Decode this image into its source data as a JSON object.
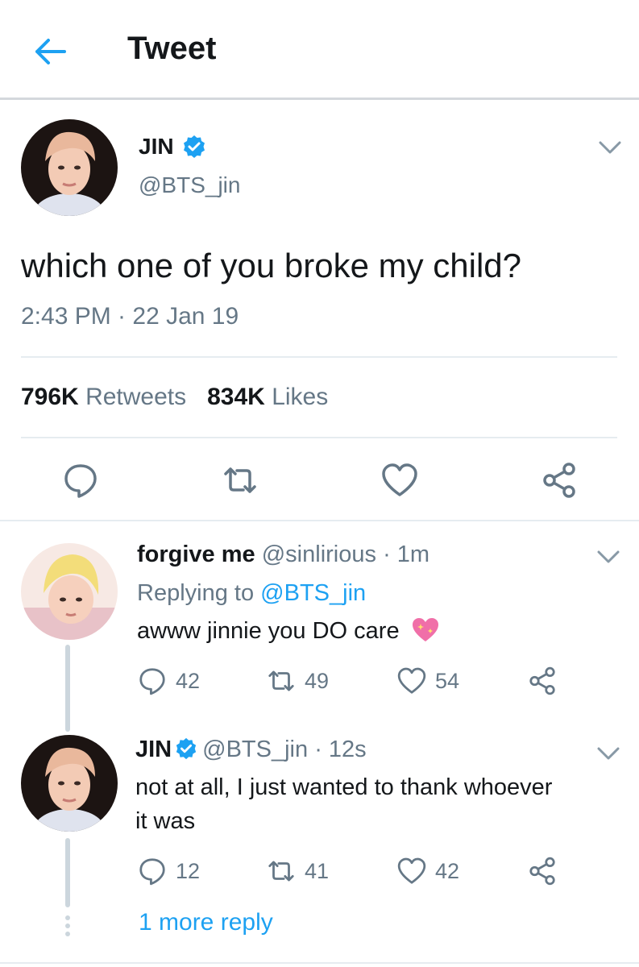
{
  "header": {
    "title": "Tweet",
    "back_icon": "arrow-left-icon"
  },
  "colors": {
    "accent": "#1da1f2",
    "muted": "#657786",
    "text": "#14171a",
    "divider": "#e6ecf0"
  },
  "main_tweet": {
    "name": "JIN",
    "handle": "@BTS_jin",
    "text": "which one of you broke my child?",
    "timestamp": "2:43 PM · 22 Jan 19",
    "retweets_count": "796K",
    "retweets_label": "Retweets",
    "likes_count": "834K",
    "likes_label": "Likes",
    "actions": [
      "reply-icon",
      "retweet-icon",
      "like-icon",
      "share-icon"
    ]
  },
  "replies": [
    {
      "name": "forgive me",
      "handle": "@sinlirious",
      "time": "· 1m",
      "replying_prefix": "Replying to",
      "replying_to": "@BTS_jin",
      "text": "awww jinnie you DO care",
      "reply_count": "42",
      "retweet_count": "49",
      "like_count": "54"
    },
    {
      "name": "JIN",
      "handle": "@BTS_jin",
      "time": "· 12s",
      "text_line1": "not at all, I just wanted to thank whoever",
      "text_line2": "it was",
      "reply_count": "12",
      "retweet_count": "41",
      "like_count": "42"
    }
  ],
  "more_replies": "1 more reply"
}
